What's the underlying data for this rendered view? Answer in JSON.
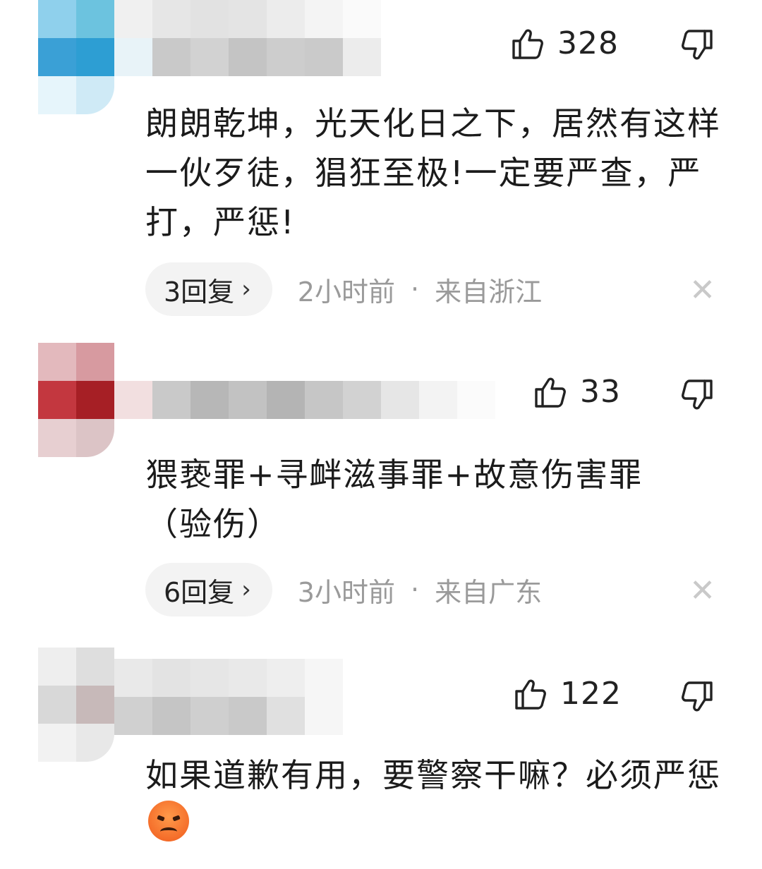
{
  "comments": [
    {
      "likes": "328",
      "text": "朗朗乾坤，光天化日之下，居然有这样一伙歹徒，猖狂至极!一定要严查，严打，严惩!",
      "reply_label": "3回复",
      "time": "2小时前",
      "dot": "·",
      "location": "来自浙江",
      "avatar_colors": [
        "#8fd0ec",
        "#6cc3df",
        "#3aa0d6",
        "#2d9ed3",
        "#e6f5fb",
        "#cfeaf6"
      ],
      "uname_colors": [
        "#eeeeee",
        "#e0e0e0",
        "#dedede",
        "#e4e4e4",
        "#ececec",
        "#f2f2f2"
      ],
      "uname_colors_bot": [
        "#c9c9c9",
        "#d2d2d2",
        "#c4c4c4",
        "#cdcdcd",
        "#cacaca",
        "#ececec"
      ]
    },
    {
      "likes": "33",
      "text": "猥亵罪+寻衅滋事罪+故意伤害罪（验伤）",
      "reply_label": "6回复",
      "time": "3小时前",
      "dot": "·",
      "location": "来自广东",
      "avatar_colors": [
        "#e3b9bd",
        "#d79aa0",
        "#c3373f",
        "#a61f25",
        "#e7cfd1",
        "#dcc4c6"
      ],
      "uname_colors": [
        "#cfcfcf",
        "#b9b9b9",
        "#c4c4c4",
        "#b4b4b4",
        "#c9c9c9",
        "#e0e0e0"
      ]
    },
    {
      "likes": "122",
      "text": "如果道歉有用，要警察干嘛？必须严惩",
      "avatar_colors": [
        "#eeeeee",
        "#dedede",
        "#d8d8d8",
        "#c7b9b9",
        "#f2f2f2",
        "#e8e8e8"
      ],
      "uname_colors": [
        "#e9e9e9",
        "#e3e3e3",
        "#e6e6e6",
        "#e9e9e9",
        "#eeeeee"
      ],
      "uname_colors_bot": [
        "#d0d0d0",
        "#c5c5c5",
        "#cfcfcf",
        "#c9c9c9",
        "#e0e0e0"
      ]
    }
  ],
  "icons": {
    "like": "thumbs-up-icon",
    "dislike": "thumbs-down-icon",
    "close": "close-icon",
    "emoji": "angry-face-emoji"
  },
  "close_glyph": "✕",
  "chevron_glyph": "›"
}
